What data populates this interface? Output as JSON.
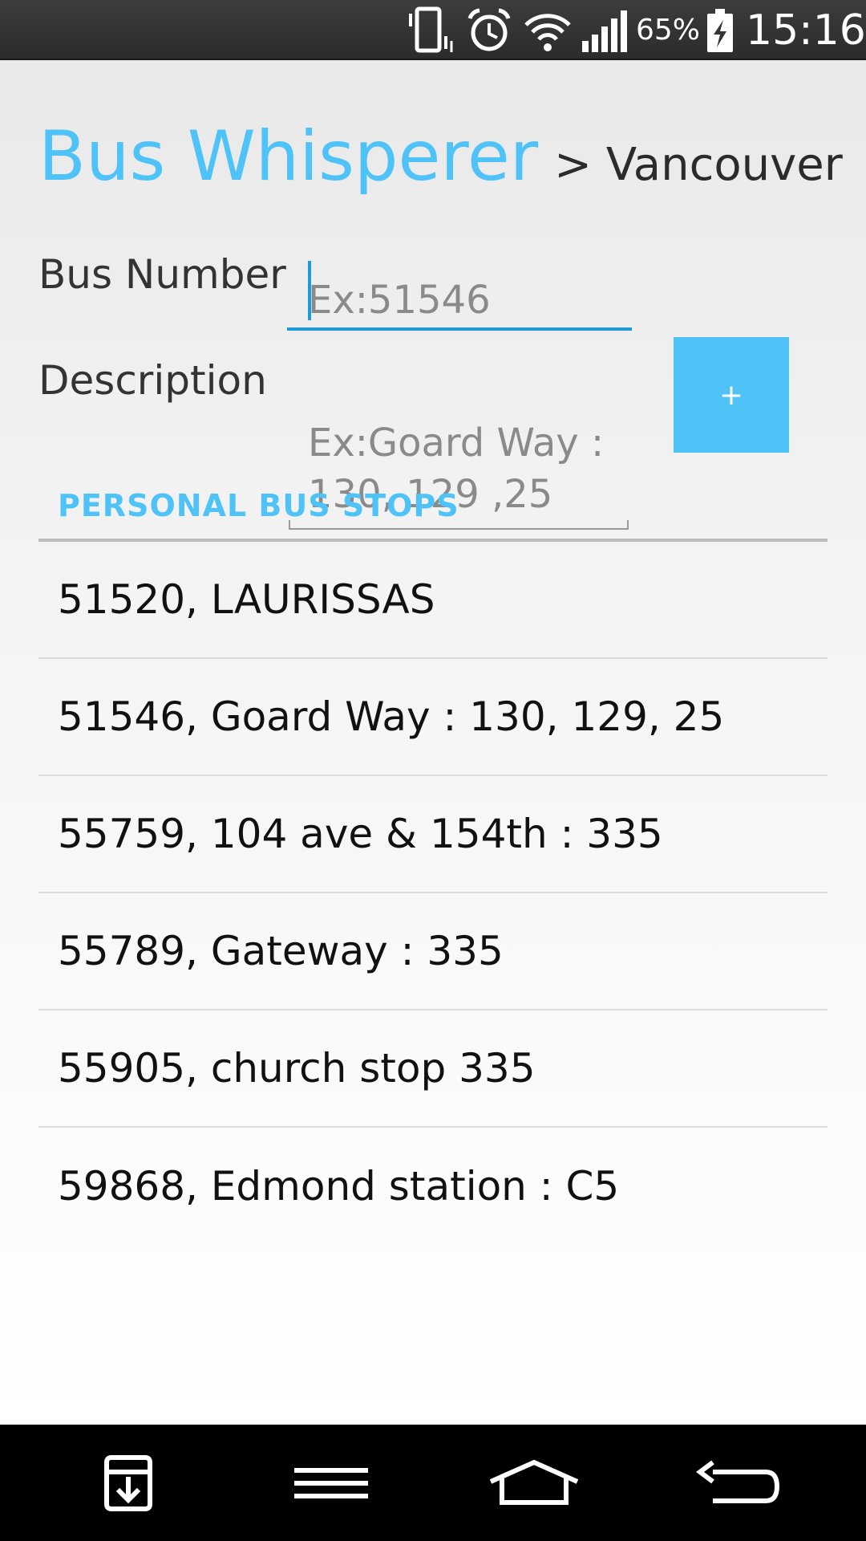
{
  "status_bar": {
    "battery_percent": "65%",
    "time": "15:16",
    "icons": [
      "vibrate-icon",
      "alarm-icon",
      "wifi-icon",
      "signal-icon",
      "battery-charging-icon"
    ]
  },
  "header": {
    "app_name": "Bus Whisperer",
    "city": "> Vancouver"
  },
  "form": {
    "bus_number_label": "Bus Number",
    "bus_number_placeholder": "Ex:51546",
    "bus_number_value": "",
    "description_label": "Description",
    "description_placeholder": "Ex:Goard Way : 130, 129 ,25",
    "description_value": "",
    "add_button_label": "+"
  },
  "list": {
    "section_title": "PERSONAL BUS STOPS",
    "items": [
      "51520, LAURISSAS",
      "51546, Goard Way : 130, 129, 25",
      "55759, 104 ave & 154th : 335",
      "55789, Gateway : 335",
      "55905, church stop 335",
      "59868, Edmond station : C5"
    ]
  },
  "nav_bar": {
    "icons": [
      "download-icon",
      "menu-icon",
      "home-icon",
      "back-icon"
    ]
  },
  "colors": {
    "accent": "#4fc3f7",
    "focus_underline": "#1e9bd7"
  }
}
